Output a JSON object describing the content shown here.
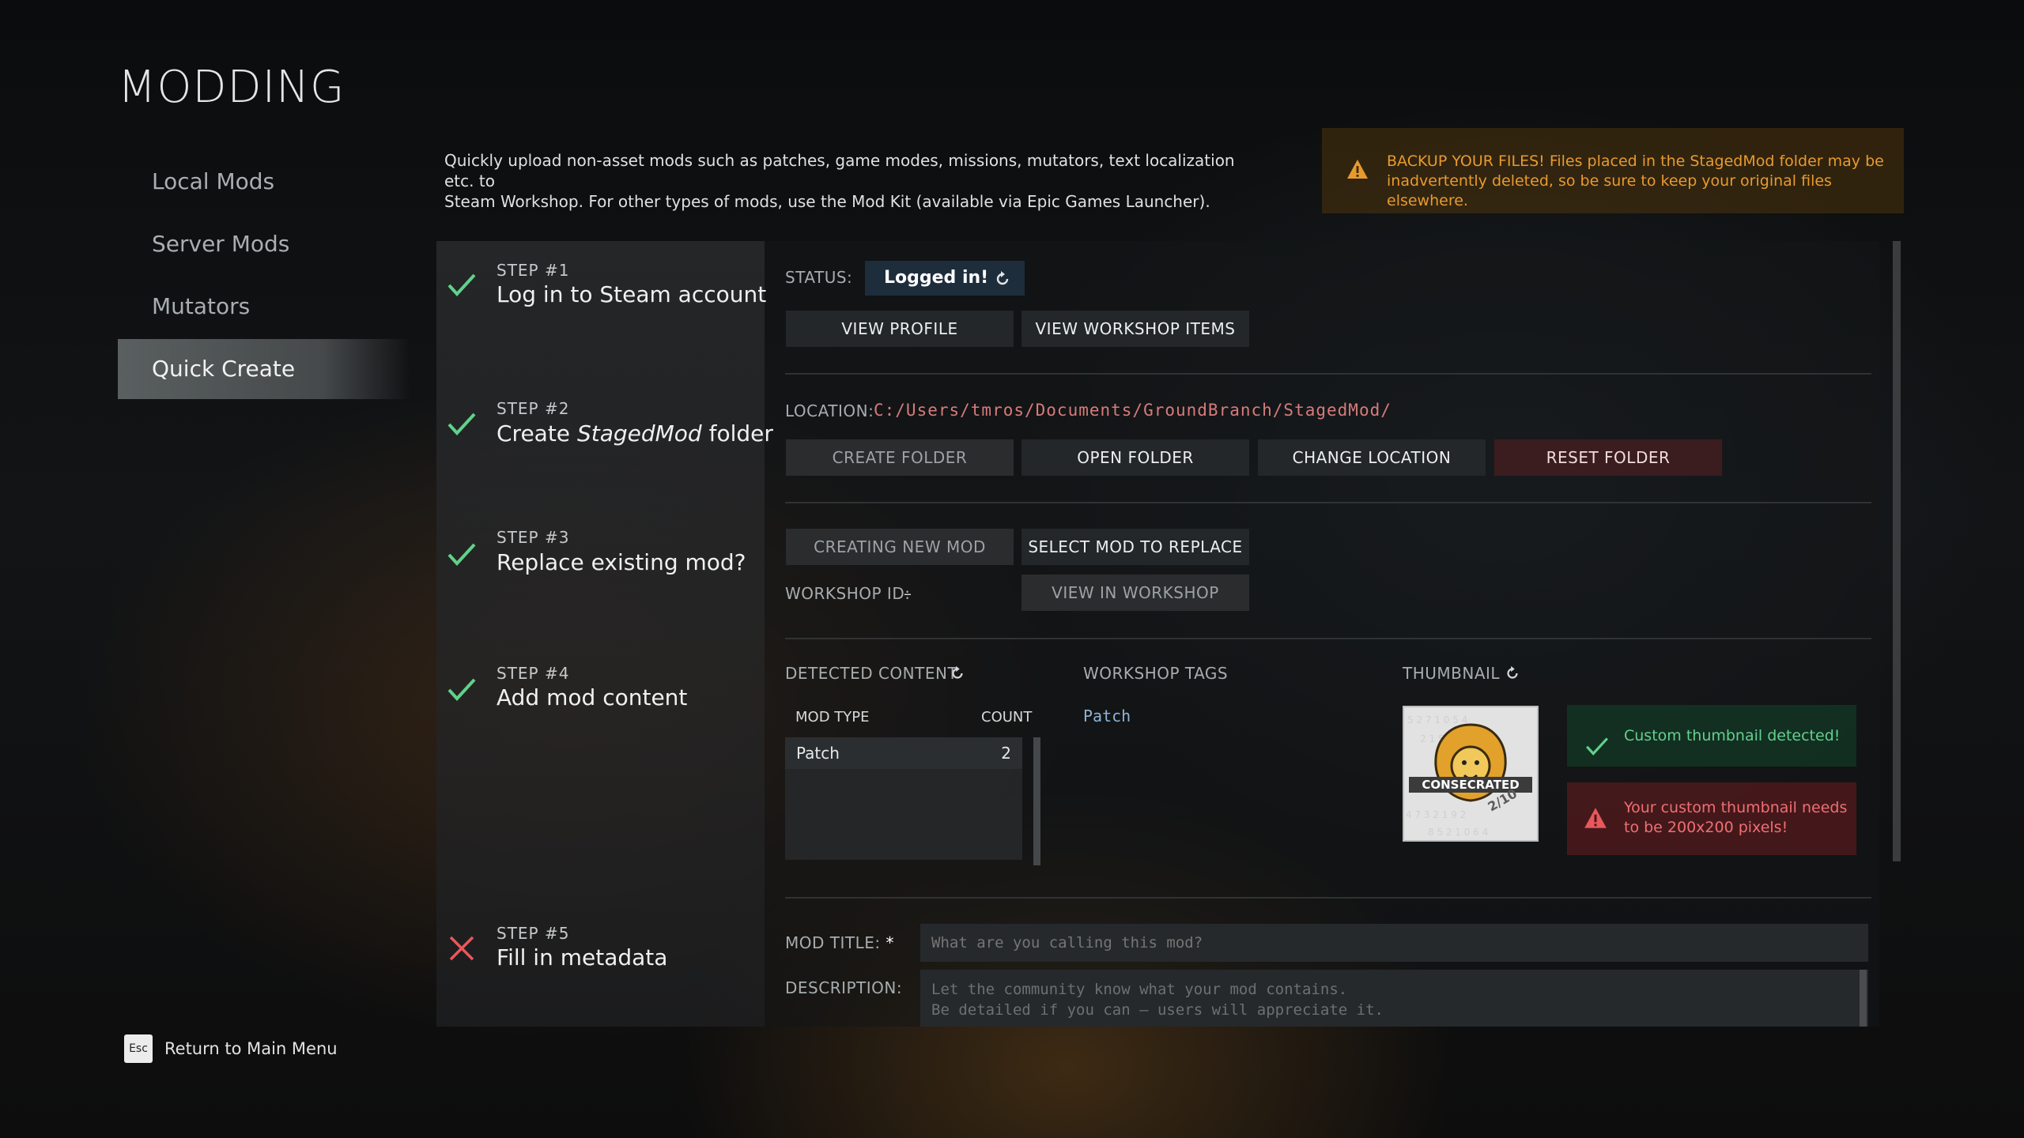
{
  "page": {
    "title": "MODDING"
  },
  "sidebar": {
    "items": [
      {
        "label": "Local Mods"
      },
      {
        "label": "Server Mods"
      },
      {
        "label": "Mutators"
      },
      {
        "label": "Quick Create"
      }
    ]
  },
  "intro": {
    "line1": "Quickly upload non-asset mods such as patches, game modes, missions, mutators, text localization etc. to",
    "line2": "Steam Workshop. For other types of mods, use the Mod Kit (available via Epic Games Launcher)."
  },
  "warning": {
    "line1": "BACKUP YOUR FILES! Files placed in the StagedMod folder may be",
    "line2": "inadvertently deleted, so be sure to keep your original files elsewhere."
  },
  "steps": [
    {
      "num": "STEP #1",
      "title": "Log in to Steam account",
      "state": "done"
    },
    {
      "num": "STEP #2",
      "title_pre": "Create ",
      "title_em": "StagedMod",
      "title_post": " folder",
      "state": "done"
    },
    {
      "num": "STEP #3",
      "title": "Replace existing mod?",
      "state": "done"
    },
    {
      "num": "STEP #4",
      "title": "Add mod content",
      "state": "done"
    },
    {
      "num": "STEP #5",
      "title": "Fill in metadata",
      "state": "failed"
    }
  ],
  "step1": {
    "status_label": "STATUS:",
    "status_value": "Logged in!",
    "view_profile": "VIEW PROFILE",
    "view_workshop_items": "VIEW WORKSHOP ITEMS"
  },
  "step2": {
    "location_label": "LOCATION:",
    "location_path": "C:/Users/tmros/Documents/GroundBranch/StagedMod/",
    "create_folder": "CREATE FOLDER",
    "open_folder": "OPEN FOLDER",
    "change_location": "CHANGE LOCATION",
    "reset_folder": "RESET FOLDER"
  },
  "step3": {
    "creating_new_mod": "CREATING NEW MOD",
    "select_mod": "SELECT MOD TO REPLACE",
    "workshop_id_label": "WORKSHOP ID:",
    "workshop_id_value": "–",
    "view_in_workshop": "VIEW IN WORKSHOP"
  },
  "step4": {
    "detected_label": "DETECTED CONTENT",
    "col_mod_type": "MOD TYPE",
    "col_count": "COUNT",
    "rows": [
      {
        "type": "Patch",
        "count": "2"
      }
    ],
    "tags_label": "WORKSHOP TAGS",
    "tag": "Patch",
    "thumbnail_label": "THUMBNAIL",
    "thumb_ok": "Custom thumbnail detected!",
    "thumb_err_line1": "Your custom thumbnail needs",
    "thumb_err_line2": "to be 200x200 pixels!",
    "thumb_logo_text": "CONSECRATED"
  },
  "step5": {
    "mod_title_label": "MOD TITLE:",
    "required_mark": "*",
    "mod_title_placeholder": "What are you calling this mod?",
    "description_label": "DESCRIPTION:",
    "description_placeholder_line1": "Let the community know what your mod contains.",
    "description_placeholder_line2": "Be detailed if you can – users will appreciate it."
  },
  "footer": {
    "esc_key": "Esc",
    "return_label": "Return to Main Menu"
  },
  "colors": {
    "success": "#5fd28a",
    "danger": "#e8585c",
    "warning": "#e89a2e",
    "path": "#d77b7b",
    "tag": "#8fb3d6"
  }
}
